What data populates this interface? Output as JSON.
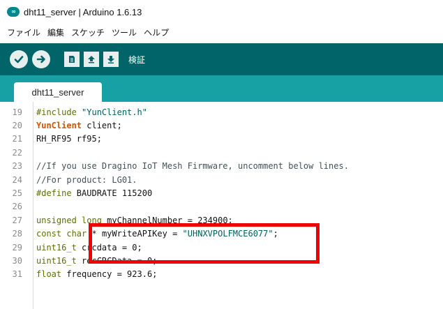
{
  "window": {
    "title": "dht11_server | Arduino 1.6.13",
    "logo_text": "∞"
  },
  "menu": [
    "ファイル",
    "編集",
    "スケッチ",
    "ツール",
    "ヘルプ"
  ],
  "toolbar": {
    "buttons": [
      "verify-icon",
      "upload-icon",
      "new-icon",
      "open-icon",
      "save-icon"
    ],
    "label": "検証",
    "accent_color": "#006468"
  },
  "tabs": [
    {
      "label": "dht11_server"
    }
  ],
  "editor": {
    "lines": [
      {
        "num": "19",
        "parts": [
          {
            "t": "#include",
            "c": "kw"
          },
          {
            "t": " \"YunClient.h\"",
            "c": "str"
          }
        ]
      },
      {
        "num": "20",
        "parts": [
          {
            "t": "YunClient",
            "c": "kw2"
          },
          {
            "t": " client;",
            "c": ""
          }
        ]
      },
      {
        "num": "21",
        "parts": [
          {
            "t": "RH_RF95 rf95;",
            "c": ""
          }
        ]
      },
      {
        "num": "22",
        "parts": [
          {
            "t": "",
            "c": ""
          }
        ]
      },
      {
        "num": "23",
        "parts": [
          {
            "t": "//If you use Dragino IoT Mesh Firmware, uncomment below lines.",
            "c": "cm"
          }
        ]
      },
      {
        "num": "24",
        "parts": [
          {
            "t": "//For product: LG01.",
            "c": "cm"
          }
        ]
      },
      {
        "num": "25",
        "parts": [
          {
            "t": "#define",
            "c": "kw"
          },
          {
            "t": " BAUDRATE 115200",
            "c": ""
          }
        ]
      },
      {
        "num": "26",
        "parts": [
          {
            "t": "",
            "c": ""
          }
        ]
      },
      {
        "num": "27",
        "parts": [
          {
            "t": "unsigned",
            "c": "kw"
          },
          {
            "t": " ",
            "c": ""
          },
          {
            "t": "long",
            "c": "kw"
          },
          {
            "t": " myChannelNumber = 234900;",
            "c": ""
          }
        ]
      },
      {
        "num": "28",
        "parts": [
          {
            "t": "const",
            "c": "kw"
          },
          {
            "t": " ",
            "c": ""
          },
          {
            "t": "char",
            "c": "kw"
          },
          {
            "t": " * myWriteAPIKey = ",
            "c": ""
          },
          {
            "t": "\"UHNXVPOLFMCE6077\"",
            "c": "str"
          },
          {
            "t": ";",
            "c": ""
          }
        ]
      },
      {
        "num": "29",
        "parts": [
          {
            "t": "uint16_t",
            "c": "kw"
          },
          {
            "t": " crcdata = 0;",
            "c": ""
          }
        ]
      },
      {
        "num": "30",
        "parts": [
          {
            "t": "uint16_t",
            "c": "kw"
          },
          {
            "t": " recCRCData = 0;",
            "c": ""
          }
        ]
      },
      {
        "num": "31",
        "parts": [
          {
            "t": "float",
            "c": "kw"
          },
          {
            "t": " frequency = 923.6;",
            "c": ""
          }
        ]
      }
    ],
    "highlight_color": "#ee0000"
  }
}
